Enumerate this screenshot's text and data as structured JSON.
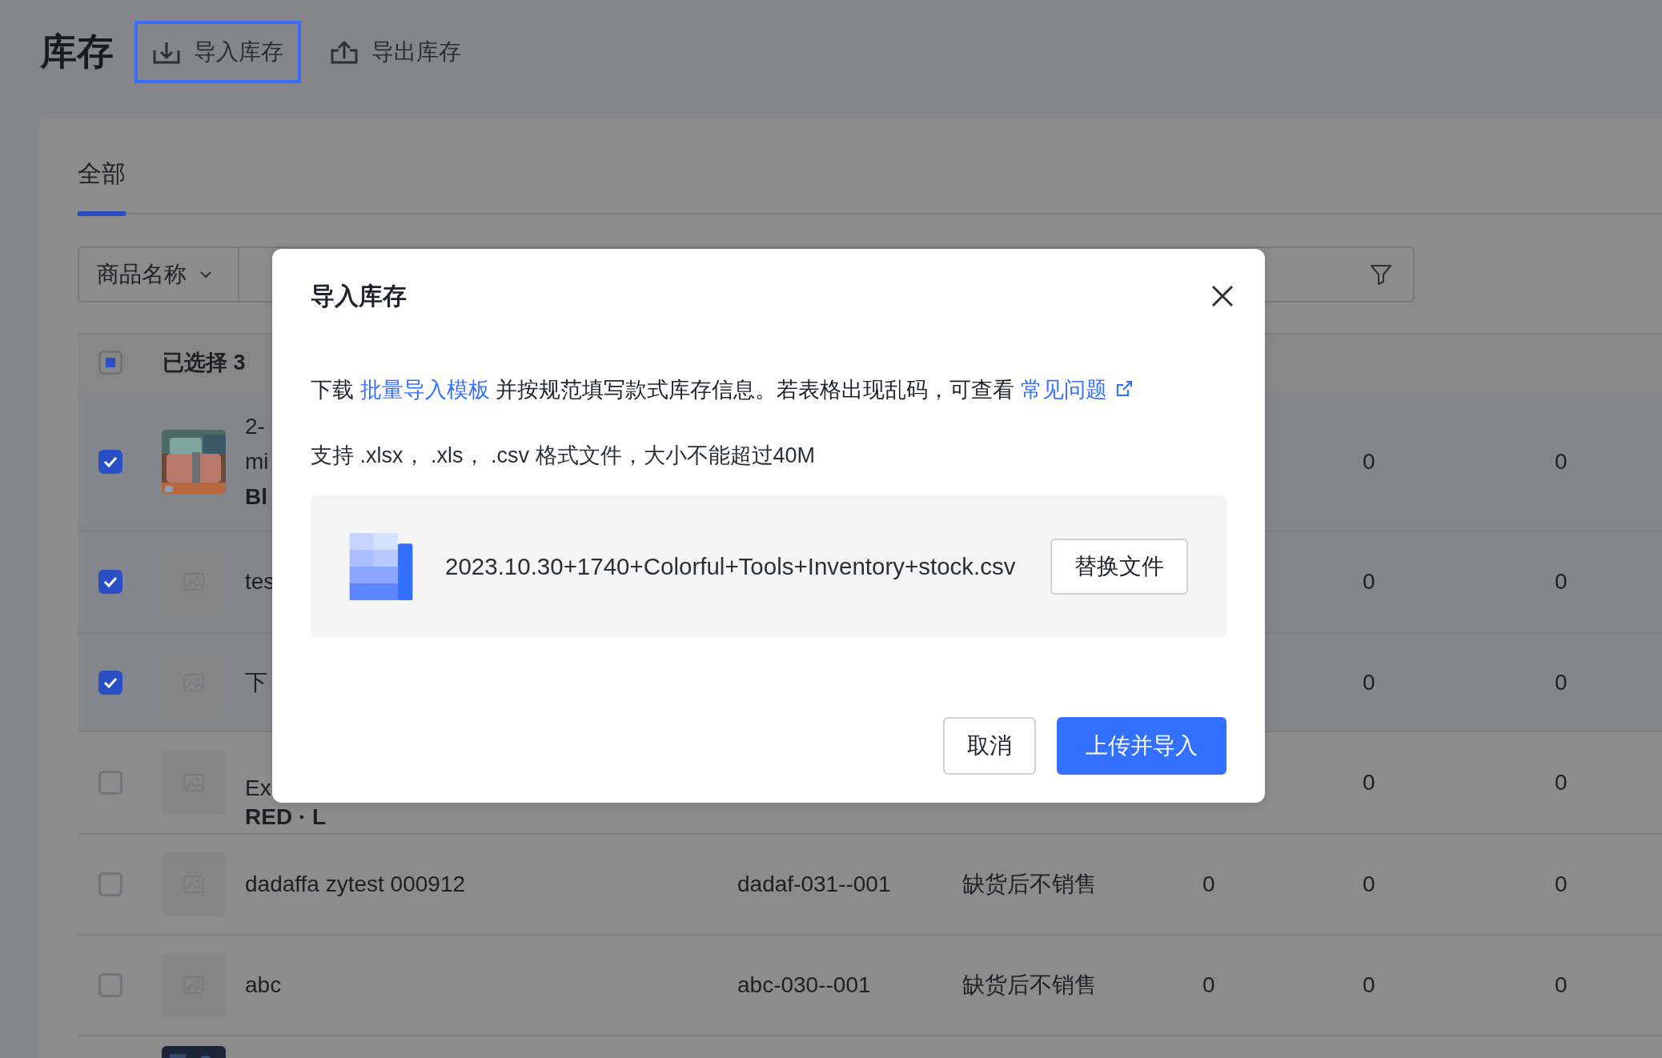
{
  "page": {
    "title": "库存",
    "actions": [
      {
        "label": "导入库存",
        "focused": true
      },
      {
        "label": "导出库存",
        "focused": false
      }
    ]
  },
  "tabs": [
    {
      "label": "全部",
      "selected": true
    }
  ],
  "filter": {
    "field_select": "商品名称"
  },
  "table": {
    "header": {
      "indeterminate": true,
      "selection_text": "已选择 3"
    },
    "rows": [
      {
        "checked": true,
        "kind": "picture",
        "name_lines": [
          "2-",
          "mi"
        ],
        "variant": "Bl",
        "column_6": "0",
        "column_7": "0"
      },
      {
        "checked": true,
        "name_lines": [
          "tes"
        ],
        "column_6": "0",
        "column_7": "0"
      },
      {
        "checked": true,
        "name_lines": [
          "下"
        ],
        "column_6": "0",
        "column_7": "0"
      },
      {
        "checked": false,
        "name_lines": [
          "Ex"
        ],
        "variant": "RED · L",
        "column_6": "0",
        "column_7": "0"
      },
      {
        "checked": false,
        "name_lines": [
          "dadaffa zytest 000912"
        ],
        "sku": "dadaf-031--001",
        "policy": "缺货后不销售",
        "column_5": "0",
        "column_6": "0",
        "column_7": "0"
      },
      {
        "checked": false,
        "name_lines": [
          "abc"
        ],
        "sku": "abc-030--001",
        "policy": "缺货后不销售",
        "column_5": "0",
        "column_6": "0",
        "column_7": "0"
      },
      {
        "kind": "picture"
      }
    ]
  },
  "modal": {
    "title": "导入库存",
    "intro": [
      {
        "kind": "text",
        "text": "下载 "
      },
      {
        "kind": "link",
        "text": "批量导入模板"
      },
      {
        "kind": "text",
        "text": " 并按规范填写款式库存信息。若表格出现乱码，可查看 "
      },
      {
        "kind": "link",
        "text": "常见问题",
        "external": true
      }
    ],
    "formats": "支持 .xlsx， .xls， .csv 格式文件，大小不能超过40M",
    "file": {
      "name": "2023.10.30+1740+Colorful+Tools+Inventory+stock.csv",
      "replace_button": "替换文件"
    },
    "buttons": [
      {
        "label": "取消",
        "kind": "secondary"
      },
      {
        "label": "上传并导入",
        "kind": "primary"
      }
    ]
  }
}
